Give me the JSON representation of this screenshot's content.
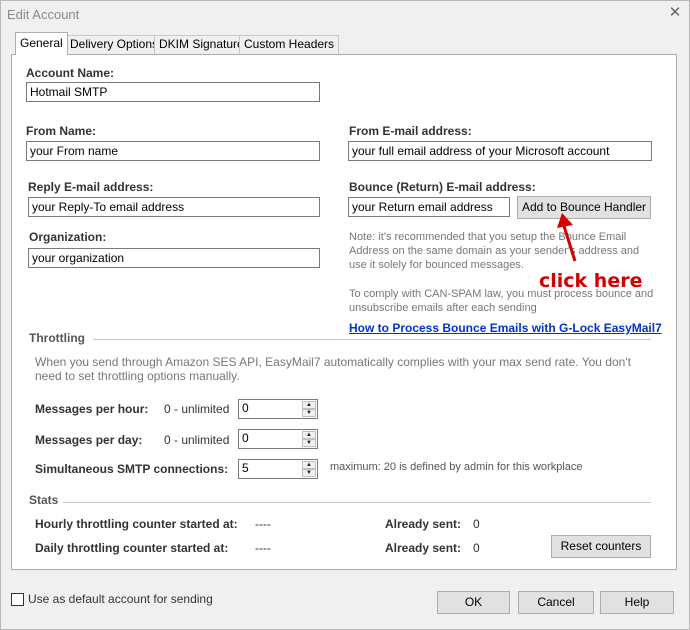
{
  "window": {
    "title": "Edit Account",
    "close_glyph": "✕"
  },
  "tabs": [
    {
      "label": "General",
      "active": true
    },
    {
      "label": "Delivery Options",
      "active": false
    },
    {
      "label": "DKIM Signature",
      "active": false
    },
    {
      "label": "Custom Headers",
      "active": false
    }
  ],
  "general": {
    "account_name_label": "Account Name:",
    "account_name_value": "Hotmail SMTP",
    "from_name_label": "From Name:",
    "from_name_value": "your From name",
    "from_email_label": "From E-mail address:",
    "from_email_value": "your full email address of your Microsoft account",
    "reply_email_label": "Reply E-mail address:",
    "reply_email_value": "your Reply-To email address",
    "bounce_email_label": "Bounce (Return) E-mail address:",
    "bounce_email_value": "your Return email address",
    "bounce_button": "Add to Bounce Handler",
    "organization_label": "Organization:",
    "organization_value": "your organization",
    "bounce_note": "Note: it's recommended that you setup the Bounce Email Address on the same domain as your sender's address and use it solely for bounced messages.",
    "canspam_note": "To comply with CAN-SPAM law, you must process bounce and unsubscribe emails after each sending",
    "bounce_link": "How to Process Bounce Emails with G-Lock EasyMail7"
  },
  "annotation": {
    "text": "click here",
    "color": "#d40000"
  },
  "throttling": {
    "heading": "Throttling",
    "description": "When you send through Amazon SES API, EasyMail7 automatically complies with your max send rate. You don't need to set throttling options manually.",
    "per_hour_label": "Messages per hour:",
    "per_hour_hint": "0 - unlimited",
    "per_hour_value": "0",
    "per_day_label": "Messages per day:",
    "per_day_hint": "0 - unlimited",
    "per_day_value": "0",
    "connections_label": "Simultaneous SMTP connections:",
    "connections_value": "5",
    "connections_hint": "maximum: 20 is defined by admin for this workplace"
  },
  "stats": {
    "heading": "Stats",
    "hourly_label": "Hourly throttling counter started at:",
    "hourly_value": "----",
    "daily_label": "Daily throttling counter started at:",
    "daily_value": "----",
    "already_sent_label": "Already sent:",
    "hourly_sent": "0",
    "daily_sent": "0",
    "reset_button": "Reset counters"
  },
  "footer": {
    "default_checkbox_label": "Use as default account for sending",
    "ok": "OK",
    "cancel": "Cancel",
    "help": "Help"
  }
}
